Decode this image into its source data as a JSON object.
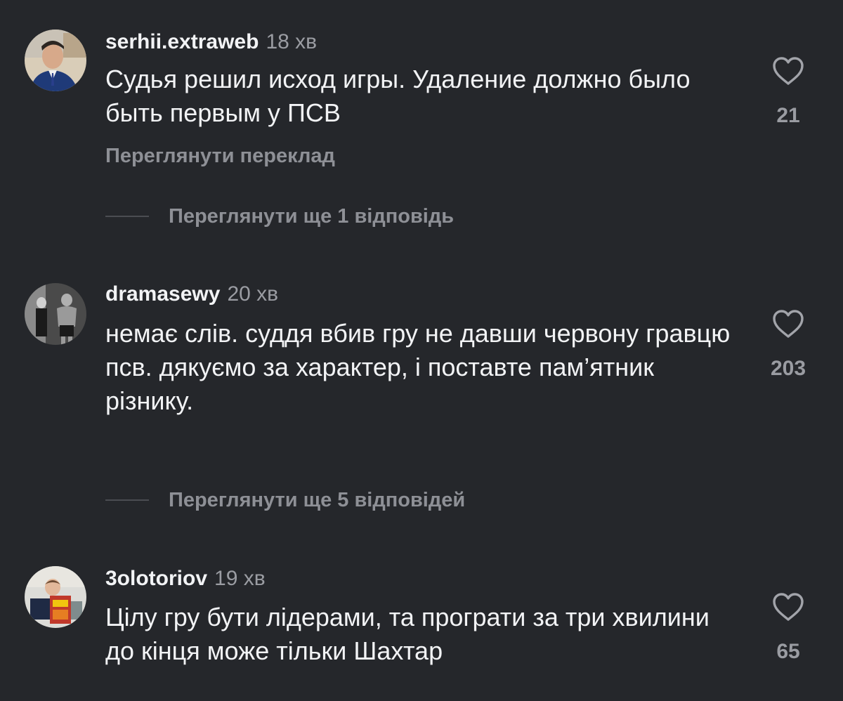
{
  "comments": [
    {
      "username": "serhii.extraweb",
      "time": "18 хв",
      "text": "Судья решил исход игры. Удаление должно было быть первым у ПСВ",
      "likes": "21",
      "translate_label": "Переглянути переклад",
      "replies_label": "Переглянути ще 1 відповідь"
    },
    {
      "username": "dramasewy",
      "time": "20 хв",
      "text": "немає слів. суддя вбив гру не давши червону гравцю псв. дякуємо за характер, і поставте пам’ятник різнику.",
      "likes": "203",
      "replies_label": "Переглянути ще 5 відповідей"
    },
    {
      "username": "3olotoriov",
      "time": "19 хв",
      "text": "Цілу гру бути лідерами, та програти за три хвилини до кінця може тільки Шахтар",
      "likes": "65"
    }
  ],
  "icons": {
    "like": "heart-outline-icon"
  },
  "colors": {
    "background": "#25272b",
    "primary_text": "#f2f3f5",
    "secondary_text": "#9a9ca2",
    "muted_bold": "#8e9096"
  }
}
